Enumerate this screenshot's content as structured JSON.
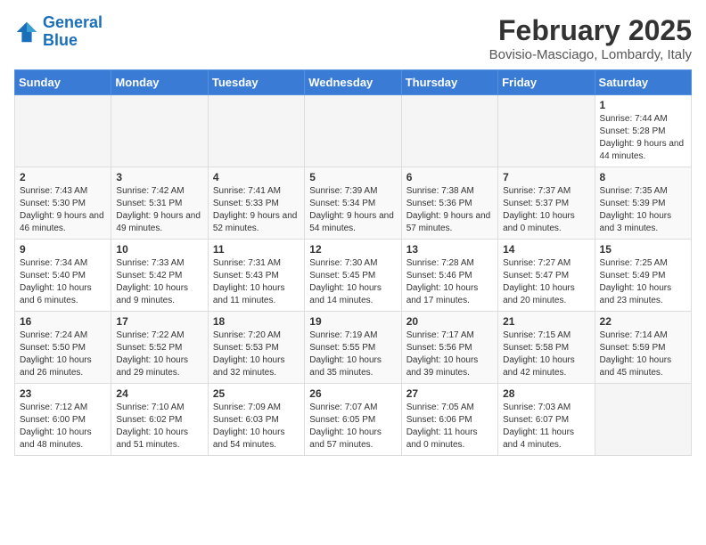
{
  "header": {
    "logo_line1": "General",
    "logo_line2": "Blue",
    "month_title": "February 2025",
    "location": "Bovisio-Masciago, Lombardy, Italy"
  },
  "weekdays": [
    "Sunday",
    "Monday",
    "Tuesday",
    "Wednesday",
    "Thursday",
    "Friday",
    "Saturday"
  ],
  "weeks": [
    [
      {
        "day": "",
        "info": ""
      },
      {
        "day": "",
        "info": ""
      },
      {
        "day": "",
        "info": ""
      },
      {
        "day": "",
        "info": ""
      },
      {
        "day": "",
        "info": ""
      },
      {
        "day": "",
        "info": ""
      },
      {
        "day": "1",
        "info": "Sunrise: 7:44 AM\nSunset: 5:28 PM\nDaylight: 9 hours and 44 minutes."
      }
    ],
    [
      {
        "day": "2",
        "info": "Sunrise: 7:43 AM\nSunset: 5:30 PM\nDaylight: 9 hours and 46 minutes."
      },
      {
        "day": "3",
        "info": "Sunrise: 7:42 AM\nSunset: 5:31 PM\nDaylight: 9 hours and 49 minutes."
      },
      {
        "day": "4",
        "info": "Sunrise: 7:41 AM\nSunset: 5:33 PM\nDaylight: 9 hours and 52 minutes."
      },
      {
        "day": "5",
        "info": "Sunrise: 7:39 AM\nSunset: 5:34 PM\nDaylight: 9 hours and 54 minutes."
      },
      {
        "day": "6",
        "info": "Sunrise: 7:38 AM\nSunset: 5:36 PM\nDaylight: 9 hours and 57 minutes."
      },
      {
        "day": "7",
        "info": "Sunrise: 7:37 AM\nSunset: 5:37 PM\nDaylight: 10 hours and 0 minutes."
      },
      {
        "day": "8",
        "info": "Sunrise: 7:35 AM\nSunset: 5:39 PM\nDaylight: 10 hours and 3 minutes."
      }
    ],
    [
      {
        "day": "9",
        "info": "Sunrise: 7:34 AM\nSunset: 5:40 PM\nDaylight: 10 hours and 6 minutes."
      },
      {
        "day": "10",
        "info": "Sunrise: 7:33 AM\nSunset: 5:42 PM\nDaylight: 10 hours and 9 minutes."
      },
      {
        "day": "11",
        "info": "Sunrise: 7:31 AM\nSunset: 5:43 PM\nDaylight: 10 hours and 11 minutes."
      },
      {
        "day": "12",
        "info": "Sunrise: 7:30 AM\nSunset: 5:45 PM\nDaylight: 10 hours and 14 minutes."
      },
      {
        "day": "13",
        "info": "Sunrise: 7:28 AM\nSunset: 5:46 PM\nDaylight: 10 hours and 17 minutes."
      },
      {
        "day": "14",
        "info": "Sunrise: 7:27 AM\nSunset: 5:47 PM\nDaylight: 10 hours and 20 minutes."
      },
      {
        "day": "15",
        "info": "Sunrise: 7:25 AM\nSunset: 5:49 PM\nDaylight: 10 hours and 23 minutes."
      }
    ],
    [
      {
        "day": "16",
        "info": "Sunrise: 7:24 AM\nSunset: 5:50 PM\nDaylight: 10 hours and 26 minutes."
      },
      {
        "day": "17",
        "info": "Sunrise: 7:22 AM\nSunset: 5:52 PM\nDaylight: 10 hours and 29 minutes."
      },
      {
        "day": "18",
        "info": "Sunrise: 7:20 AM\nSunset: 5:53 PM\nDaylight: 10 hours and 32 minutes."
      },
      {
        "day": "19",
        "info": "Sunrise: 7:19 AM\nSunset: 5:55 PM\nDaylight: 10 hours and 35 minutes."
      },
      {
        "day": "20",
        "info": "Sunrise: 7:17 AM\nSunset: 5:56 PM\nDaylight: 10 hours and 39 minutes."
      },
      {
        "day": "21",
        "info": "Sunrise: 7:15 AM\nSunset: 5:58 PM\nDaylight: 10 hours and 42 minutes."
      },
      {
        "day": "22",
        "info": "Sunrise: 7:14 AM\nSunset: 5:59 PM\nDaylight: 10 hours and 45 minutes."
      }
    ],
    [
      {
        "day": "23",
        "info": "Sunrise: 7:12 AM\nSunset: 6:00 PM\nDaylight: 10 hours and 48 minutes."
      },
      {
        "day": "24",
        "info": "Sunrise: 7:10 AM\nSunset: 6:02 PM\nDaylight: 10 hours and 51 minutes."
      },
      {
        "day": "25",
        "info": "Sunrise: 7:09 AM\nSunset: 6:03 PM\nDaylight: 10 hours and 54 minutes."
      },
      {
        "day": "26",
        "info": "Sunrise: 7:07 AM\nSunset: 6:05 PM\nDaylight: 10 hours and 57 minutes."
      },
      {
        "day": "27",
        "info": "Sunrise: 7:05 AM\nSunset: 6:06 PM\nDaylight: 11 hours and 0 minutes."
      },
      {
        "day": "28",
        "info": "Sunrise: 7:03 AM\nSunset: 6:07 PM\nDaylight: 11 hours and 4 minutes."
      },
      {
        "day": "",
        "info": ""
      }
    ]
  ]
}
